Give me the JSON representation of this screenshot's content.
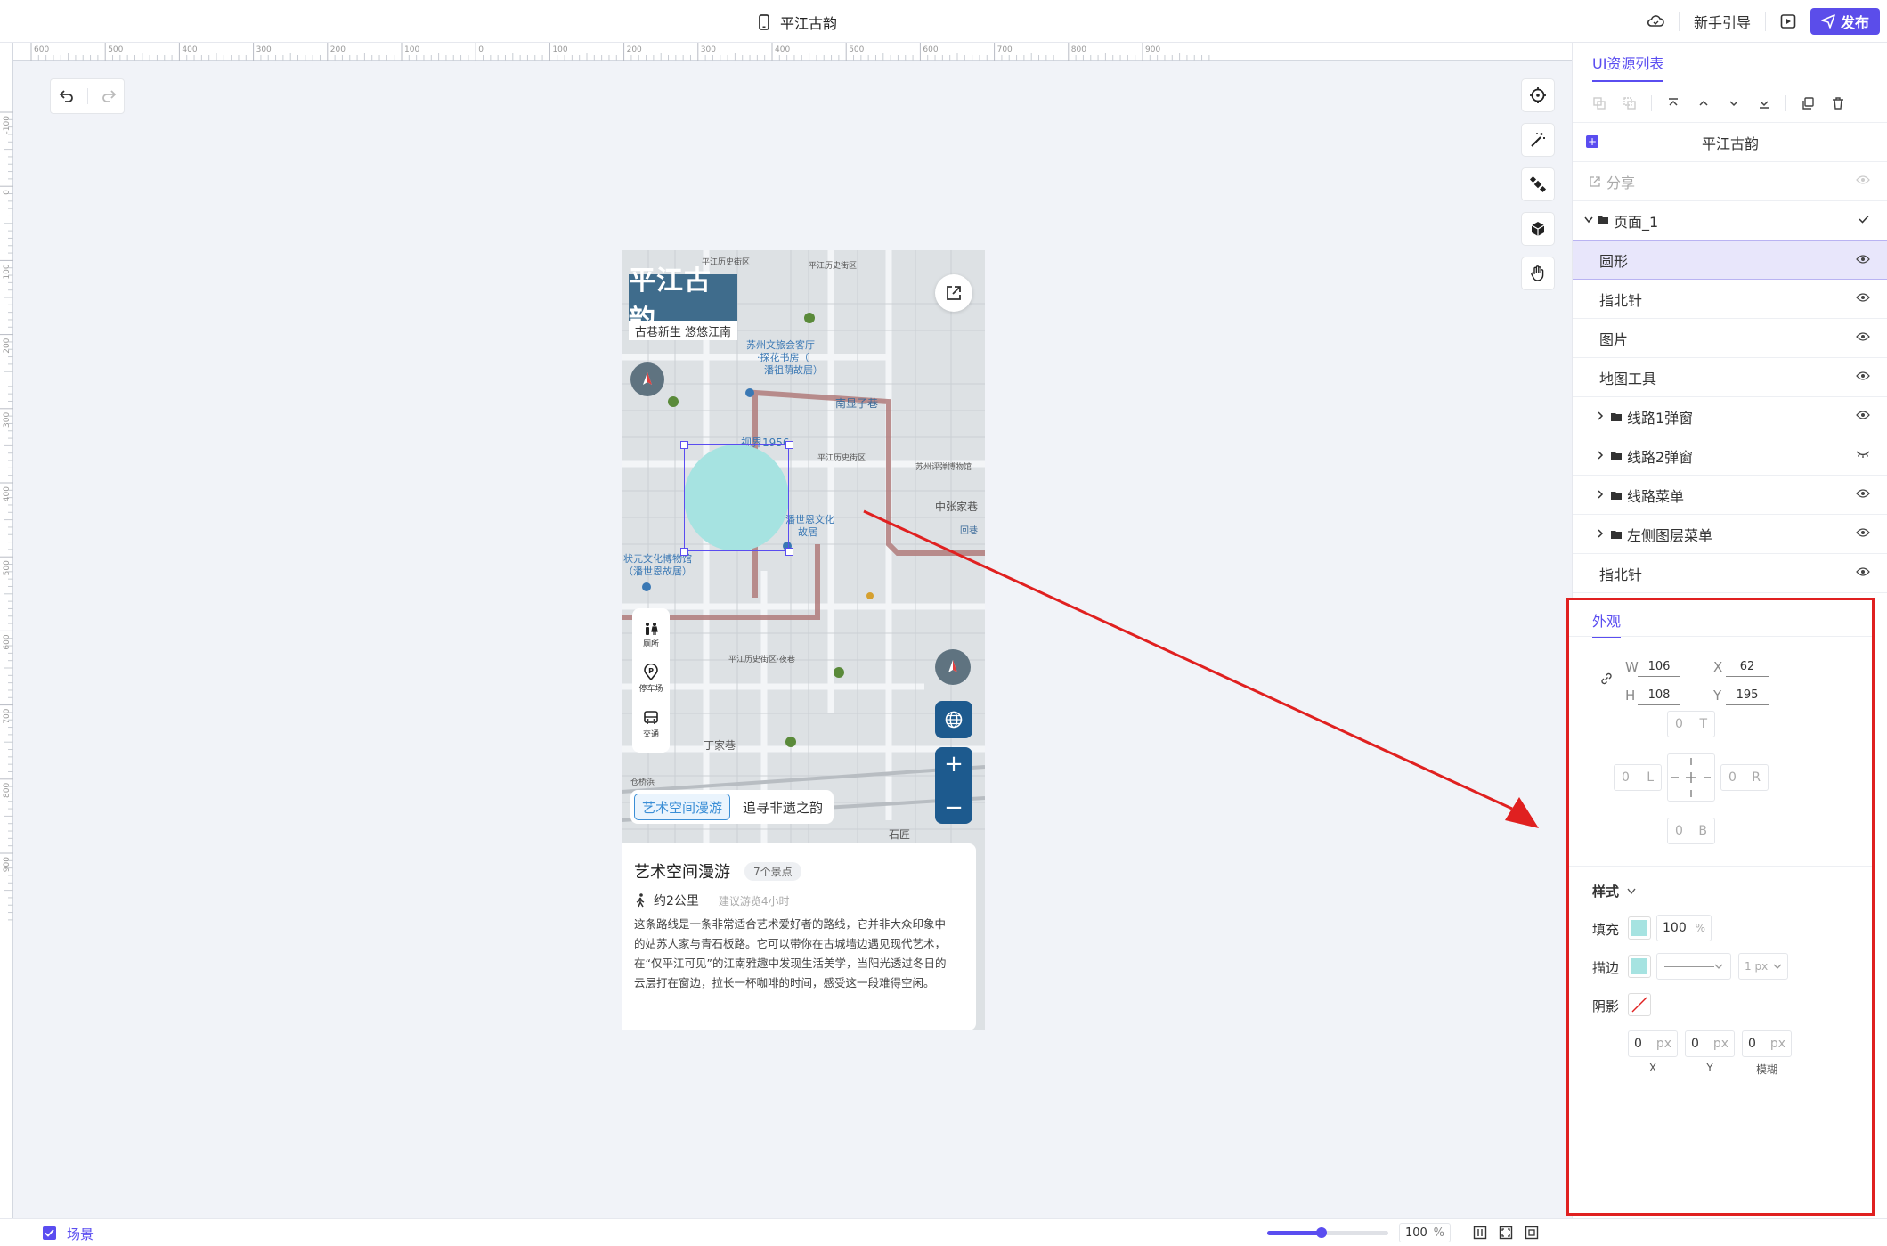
{
  "app": {
    "title": "平江古韵",
    "guide_label": "新手引导",
    "publish_label": "发布"
  },
  "ruler": {
    "top_ticks": [
      "600",
      "500",
      "400",
      "300",
      "200",
      "100",
      "0",
      "100",
      "200",
      "300",
      "400",
      "500",
      "600",
      "700",
      "800",
      "900"
    ],
    "left_ticks": [
      "-100",
      "0",
      "100",
      "200",
      "300",
      "400",
      "500",
      "600",
      "700",
      "800",
      "900"
    ]
  },
  "phone": {
    "brand_title": "平江古韵",
    "brand_subtitle": "古巷新生  悠悠江南",
    "map_labels": [
      "平江历史街区",
      "平江历史街区",
      "苏州文旅会客厅·探花书房（潘祖荫故居）",
      "南显子巷",
      "视界1956",
      "潘世恩故居",
      "状元文化博物馆（潘世恩故居）",
      "中张家巷",
      "回巷",
      "平江历史街区·夜巷",
      "平江历史街区",
      "丁家巷",
      "仓桥浜",
      "苏州评弹博物馆",
      "石匠"
    ],
    "side_menu": [
      {
        "label": "厕所",
        "icon": "toilet-icon"
      },
      {
        "label": "停车场",
        "icon": "parking-icon"
      },
      {
        "label": "交通",
        "icon": "bus-icon"
      }
    ],
    "route_tabs": [
      "艺术空间漫游",
      "追寻非遗之韵"
    ],
    "card": {
      "title": "艺术空间漫游",
      "badge": "7个景点",
      "distance": "约2公里",
      "duration": "建议游览4小时",
      "desc": "这条路线是一条非常适合艺术爱好者的路线，它并非大众印象中的姑苏人家与青石板路。它可以带你在古城墙边遇见现代艺术，在“仅平江可见”的江南雅趣中发现生活美学，当阳光透过冬日的云层打在窗边，拉长一杯咖啡的时间，感受这一段难得空闲。"
    }
  },
  "panel": {
    "tab_label": "UI资源列表",
    "project_name": "平江古韵",
    "share_label": "分享",
    "page_label": "页面_1",
    "layers": [
      {
        "label": "圆形",
        "selected": true,
        "folder": false,
        "visible": true
      },
      {
        "label": "指北针",
        "selected": false,
        "folder": false,
        "visible": true
      },
      {
        "label": "图片",
        "selected": false,
        "folder": false,
        "visible": true
      },
      {
        "label": "地图工具",
        "selected": false,
        "folder": false,
        "visible": true
      },
      {
        "label": "线路1弹窗",
        "selected": false,
        "folder": true,
        "visible": true
      },
      {
        "label": "线路2弹窗",
        "selected": false,
        "folder": true,
        "visible": false
      },
      {
        "label": "线路菜单",
        "selected": false,
        "folder": true,
        "visible": true
      },
      {
        "label": "左侧图层菜单",
        "selected": false,
        "folder": true,
        "visible": true
      },
      {
        "label": "指北针",
        "selected": false,
        "folder": false,
        "visible": true
      }
    ]
  },
  "appearance": {
    "tab_label": "外观",
    "w_label": "W",
    "w": "106",
    "h_label": "H",
    "h": "108",
    "x_label": "X",
    "x": "62",
    "y_label": "Y",
    "y": "195",
    "margin": {
      "t": "0",
      "t_label": "T",
      "l": "0",
      "l_label": "L",
      "r": "0",
      "r_label": "R",
      "b": "0",
      "b_label": "B"
    },
    "style_label": "样式",
    "fill_label": "填充",
    "fill_color": "#a6e3e1",
    "fill_opacity": "100",
    "percent": "%",
    "stroke_label": "描边",
    "stroke_width": "1",
    "unit_px": "px",
    "shadow_label": "阴影",
    "shadow_x": "0",
    "shadow_y": "0",
    "shadow_blur": "0",
    "shadow_x_label": "X",
    "shadow_y_label": "Y",
    "shadow_blur_label": "模糊"
  },
  "bottom": {
    "scene_label": "场景",
    "zoom_value": "100",
    "zoom_unit": "%",
    "zoom_fraction": 0.45
  },
  "colors": {
    "accent": "#5a4df0",
    "highlight_border": "#e02020",
    "arrow": "#e02020",
    "map_route": "#b07b7b",
    "ui_blue": "#1d5a8e"
  }
}
